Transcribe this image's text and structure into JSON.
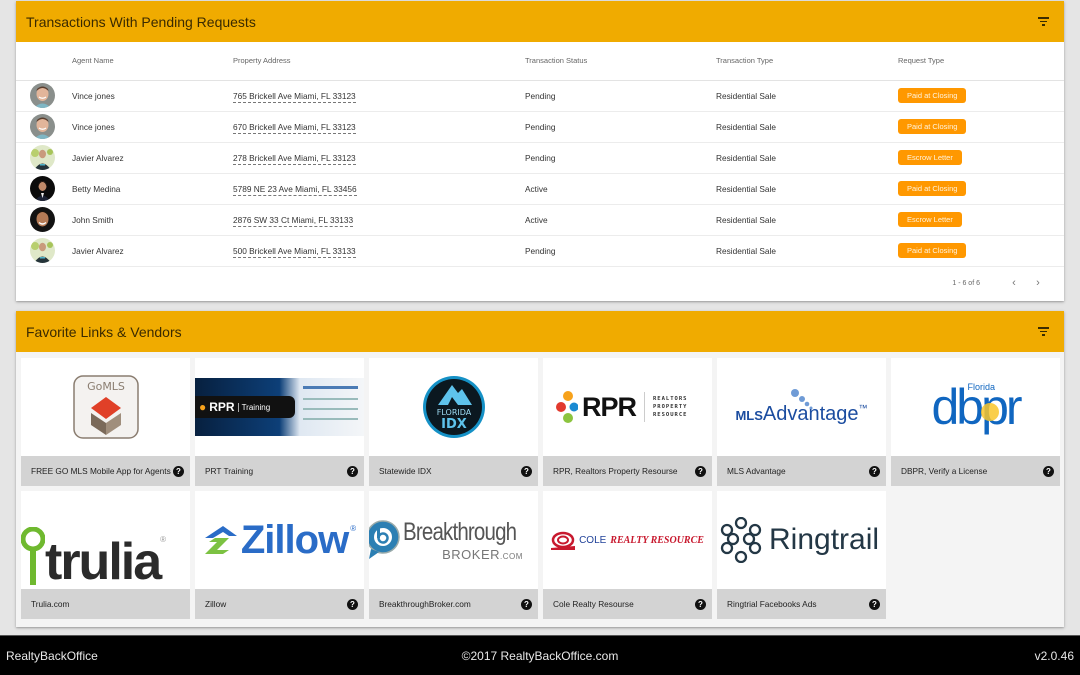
{
  "transactions": {
    "title": "Transactions With Pending Requests",
    "filter_icon": "filter-list-icon",
    "columns": [
      "",
      "Agent Name",
      "Property Address",
      "Transaction Status",
      "Transaction Type",
      "Request Type"
    ],
    "rows": [
      {
        "avatar": "vince",
        "agent": "Vince jones",
        "address": "765 Brickell Ave Miami, FL 33123",
        "status": "Pending",
        "type": "Residential Sale",
        "request": "Paid at Closing"
      },
      {
        "avatar": "vince",
        "agent": "Vince jones",
        "address": "670 Brickell Ave Miami, FL 33123",
        "status": "Pending",
        "type": "Residential Sale",
        "request": "Paid at Closing"
      },
      {
        "avatar": "javier",
        "agent": "Javier Alvarez",
        "address": "278 Brickell Ave Miami, FL 33123",
        "status": "Pending",
        "type": "Residential Sale",
        "request": "Escrow Letter"
      },
      {
        "avatar": "betty",
        "agent": "Betty Medina",
        "address": "5789 NE 23 Ave Miami, FL 33456",
        "status": "Active",
        "type": "Residential Sale",
        "request": "Paid at Closing"
      },
      {
        "avatar": "john",
        "agent": "John Smith",
        "address": "2876 SW 33 Ct Miami, FL 33133",
        "status": "Active",
        "type": "Residential Sale",
        "request": "Escrow Letter"
      },
      {
        "avatar": "javier",
        "agent": "Javier Alvarez",
        "address": "500 Brickell Ave Miami, FL 33133",
        "status": "Pending",
        "type": "Residential Sale",
        "request": "Paid at Closing"
      }
    ],
    "pagination": {
      "range": "1 - 6 of 6",
      "prev_icon": "chevron-left-icon",
      "next_icon": "chevron-right-icon"
    }
  },
  "vendors": {
    "title": "Favorite Links & Vendors",
    "filter_icon": "filter-list-icon",
    "items": [
      {
        "id": "gomls",
        "label": "FREE GO MLS Mobile App for Agents",
        "logo_text": "GoMLS",
        "help": true
      },
      {
        "id": "prt",
        "label": "PRT Training",
        "logo_text": "RPR | Training",
        "help": true
      },
      {
        "id": "idx",
        "label": "Statewide IDX",
        "logo_text": "FLORIDA IDX",
        "help": true
      },
      {
        "id": "rpr",
        "label": "RPR, Realtors Property Resourse",
        "logo_text": "RPR",
        "logo_sub": "REALTORS PROPERTY RESOURCE",
        "help": true
      },
      {
        "id": "mlsadv",
        "label": "MLS Advantage",
        "logo_text": "MLSAdvantage™",
        "help": true
      },
      {
        "id": "dbpr",
        "label": "DBPR, Verify a License",
        "logo_text": "dbpr",
        "logo_sub": "Florida",
        "help": true
      },
      {
        "id": "trulia",
        "label": "Trulia.com",
        "logo_text": "trulia",
        "help": false
      },
      {
        "id": "zillow",
        "label": "Zillow",
        "logo_text": "Zillow",
        "help": true
      },
      {
        "id": "breakthrough",
        "label": "BreakthroughBroker.com",
        "logo_text": "Breakthrough",
        "logo_sub": "BROKER.com",
        "help": true
      },
      {
        "id": "cole",
        "label": "Cole Realty Resourse",
        "logo_text": "COLE REALTY RESOURCE",
        "help": true
      },
      {
        "id": "ringtrail",
        "label": "Ringtrial Facebooks Ads",
        "logo_text": "Ringtrail",
        "help": true
      }
    ]
  },
  "footer": {
    "left": "RealtyBackOffice",
    "center": "©2017 RealtyBackOffice.com",
    "right": "v2.0.46"
  },
  "colors": {
    "header_bg": "#f0ab00",
    "badge_bg": "#ff9800",
    "footer_bg": "#000000"
  }
}
